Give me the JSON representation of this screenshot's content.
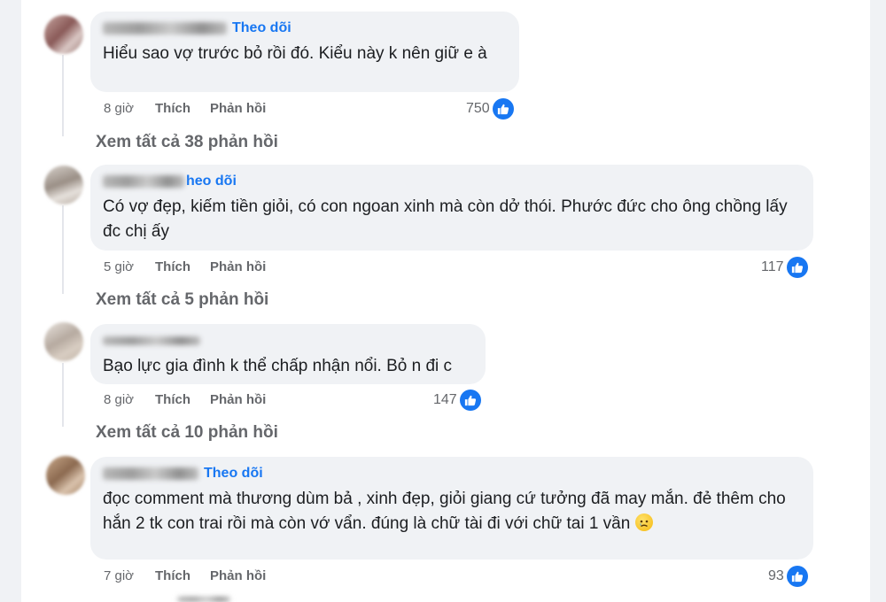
{
  "colors": {
    "accent": "#1877f2",
    "bubble": "#f0f2f5",
    "muted": "#65676b"
  },
  "comments": [
    {
      "follow_label": "Theo dõi",
      "text": "Hiểu sao vợ trước bỏ rồi đó. Kiểu này k nên giữ e à",
      "time": "8 giờ",
      "like_label": "Thích",
      "reply_label": "Phản hồi",
      "likes": "750",
      "view_replies": "Xem tất cả 38 phản hồi"
    },
    {
      "follow_label": "heo dõi",
      "text": "Có vợ đẹp, kiếm tiền giỏi, có con ngoan xinh mà còn dở thói. Phước đức cho ông chồng lấy đc chị ấy",
      "time": "5 giờ",
      "like_label": "Thích",
      "reply_label": "Phản hồi",
      "likes": "117",
      "view_replies": "Xem tất cả 5 phản hồi"
    },
    {
      "follow_label": "",
      "text": "Bạo lực gia đình k thể chấp nhận nổi. Bỏ n đi c",
      "time": "8 giờ",
      "like_label": "Thích",
      "reply_label": "Phản hồi",
      "likes": "147",
      "view_replies": "Xem tất cả 10 phản hồi"
    },
    {
      "follow_label": "Theo dõi",
      "text": "đọc comment mà thương dùm bả , xinh đẹp, giỏi giang cứ tưởng đã may mắn. đẻ thêm cho hắn 2 tk con trai rồi mà còn vớ vẩn. đúng là chữ tài đi với chữ tai 1 vần",
      "emoji": "crying-face-emoji",
      "time": "7 giờ",
      "like_label": "Thích",
      "reply_label": "Phản hồi",
      "likes": "93"
    }
  ]
}
